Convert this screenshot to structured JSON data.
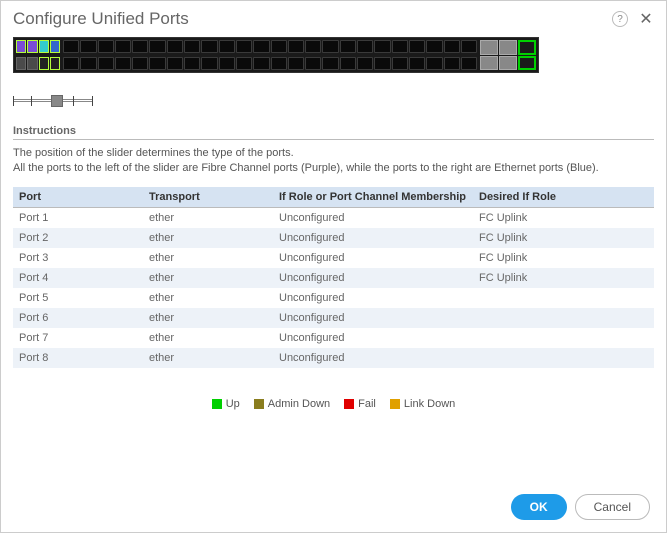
{
  "header": {
    "title": "Configure Unified Ports"
  },
  "instructions": {
    "heading": "Instructions",
    "line1": "The position of the slider determines the type of the ports.",
    "line2": "All the ports to the left of the slider are Fibre Channel ports (Purple), while the ports to the right are Ethernet ports (Blue)."
  },
  "table": {
    "headers": {
      "port": "Port",
      "transport": "Transport",
      "role": "If Role or Port Channel Membership",
      "desired": "Desired If Role"
    },
    "rows": [
      {
        "port": "Port 1",
        "transport": "ether",
        "role": "Unconfigured",
        "desired": "FC Uplink"
      },
      {
        "port": "Port 2",
        "transport": "ether",
        "role": "Unconfigured",
        "desired": "FC Uplink"
      },
      {
        "port": "Port 3",
        "transport": "ether",
        "role": "Unconfigured",
        "desired": "FC Uplink"
      },
      {
        "port": "Port 4",
        "transport": "ether",
        "role": "Unconfigured",
        "desired": "FC Uplink"
      },
      {
        "port": "Port 5",
        "transport": "ether",
        "role": "Unconfigured",
        "desired": ""
      },
      {
        "port": "Port 6",
        "transport": "ether",
        "role": "Unconfigured",
        "desired": ""
      },
      {
        "port": "Port 7",
        "transport": "ether",
        "role": "Unconfigured",
        "desired": ""
      },
      {
        "port": "Port 8",
        "transport": "ether",
        "role": "Unconfigured",
        "desired": ""
      }
    ]
  },
  "legend": {
    "up": "Up",
    "admin_down": "Admin Down",
    "fail": "Fail",
    "link_down": "Link Down"
  },
  "buttons": {
    "ok": "OK",
    "cancel": "Cancel"
  }
}
